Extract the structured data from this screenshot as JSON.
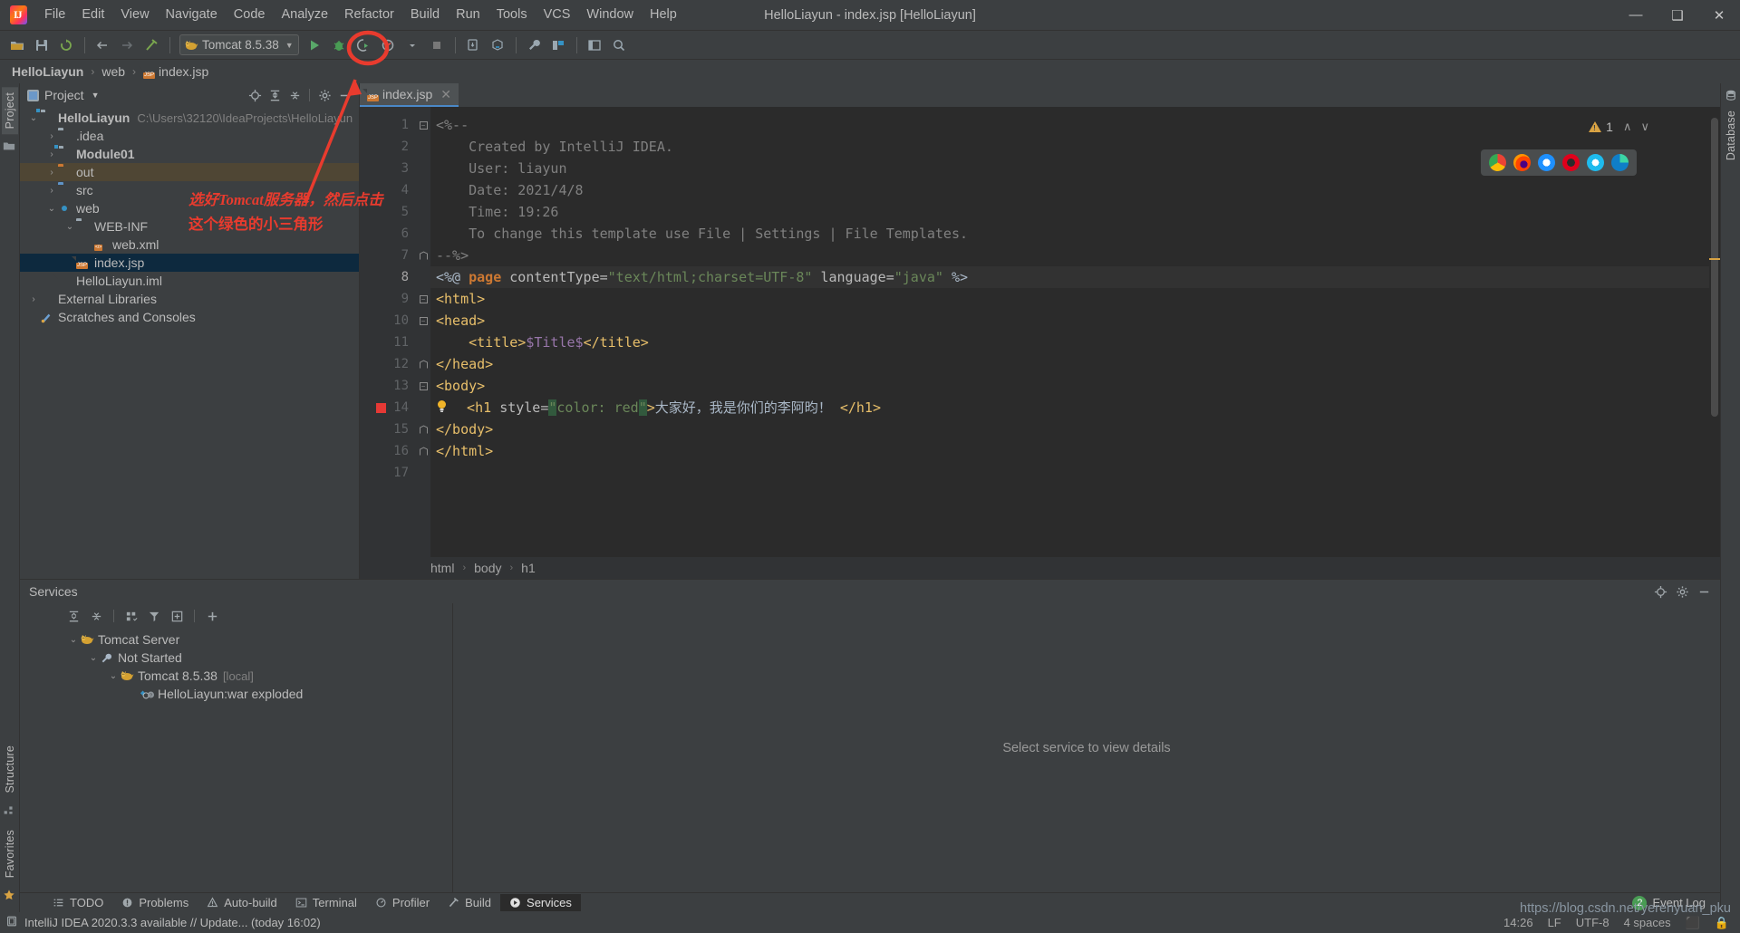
{
  "window": {
    "title": "HelloLiayun - index.jsp [HelloLiayun]",
    "minimize": "—",
    "maximize": "❑",
    "close": "✕"
  },
  "menubar": [
    {
      "label": "File"
    },
    {
      "label": "Edit"
    },
    {
      "label": "View"
    },
    {
      "label": "Navigate"
    },
    {
      "label": "Code"
    },
    {
      "label": "Analyze"
    },
    {
      "label": "Refactor"
    },
    {
      "label": "Build"
    },
    {
      "label": "Run"
    },
    {
      "label": "Tools"
    },
    {
      "label": "VCS"
    },
    {
      "label": "Window"
    },
    {
      "label": "Help"
    }
  ],
  "toolbar": {
    "run_config": "Tomcat 8.5.38",
    "caret": "▼",
    "icons": [
      "open-folder-icon",
      "save-all-icon",
      "sync-icon",
      "back-icon",
      "forward-icon",
      "build-hammer-icon",
      "run-icon",
      "debug-icon",
      "run-coverage-icon",
      "profiler-icon",
      "stop-icon",
      "update-app-icon",
      "deploy-icon",
      "settings-wrench-icon",
      "project-structure-icon",
      "layout-icon",
      "search-icon"
    ]
  },
  "navbar": {
    "crumbs": [
      {
        "label": "HelloLiayun",
        "bold": true
      },
      {
        "label": "web",
        "bold": false
      },
      {
        "label": "index.jsp",
        "bold": false
      }
    ],
    "separator": "›"
  },
  "left_strip": {
    "tabs": [
      {
        "label": "Project",
        "active": true
      }
    ],
    "extra_icon": "structure-folder-icon"
  },
  "left_strip_bottom": {
    "tabs": [
      {
        "label": "Structure"
      },
      {
        "label": "Favorites"
      }
    ]
  },
  "right_strip": {
    "tabs": [
      {
        "label": "Database"
      }
    ]
  },
  "project_panel": {
    "title": "Project",
    "caret": "▼",
    "actions": [
      "locate-target-icon",
      "expand-all-icon",
      "collapse-all-icon",
      "gear-icon",
      "hide-icon"
    ],
    "tree": [
      {
        "indent": 0,
        "arrow": "⌄",
        "icon": "folder-module-icon",
        "label": "HelloLiayun",
        "bold": true,
        "path": "C:\\Users\\32120\\IdeaProjects\\HelloLiayun",
        "state": "normal"
      },
      {
        "indent": 1,
        "arrow": "›",
        "icon": "folder-icon",
        "label": ".idea",
        "bold": false,
        "path": "",
        "state": "normal"
      },
      {
        "indent": 1,
        "arrow": "›",
        "icon": "folder-module-icon",
        "label": "Module01",
        "bold": true,
        "path": "",
        "state": "normal"
      },
      {
        "indent": 1,
        "arrow": "›",
        "icon": "folder-out-icon",
        "label": "out",
        "bold": false,
        "path": "",
        "state": "highlight"
      },
      {
        "indent": 1,
        "arrow": "›",
        "icon": "folder-source-icon",
        "label": "src",
        "bold": false,
        "path": "",
        "state": "normal"
      },
      {
        "indent": 1,
        "arrow": "⌄",
        "icon": "folder-web-icon",
        "label": "web",
        "bold": false,
        "path": "",
        "state": "normal"
      },
      {
        "indent": 2,
        "arrow": "⌄",
        "icon": "folder-icon",
        "label": "WEB-INF",
        "bold": false,
        "path": "",
        "state": "normal"
      },
      {
        "indent": 3,
        "arrow": "",
        "icon": "xml-file-icon",
        "label": "web.xml",
        "bold": false,
        "path": "",
        "state": "normal"
      },
      {
        "indent": 2,
        "arrow": "",
        "icon": "jsp-file-icon",
        "label": "index.jsp",
        "bold": false,
        "path": "",
        "state": "selected"
      },
      {
        "indent": 1,
        "arrow": "",
        "icon": "iml-file-icon",
        "label": "HelloLiayun.iml",
        "bold": false,
        "path": "",
        "state": "normal"
      },
      {
        "indent": 0,
        "arrow": "›",
        "icon": "library-icon",
        "label": "External Libraries",
        "bold": false,
        "path": "",
        "state": "normal"
      },
      {
        "indent": 0,
        "arrow": "",
        "icon": "scratches-icon",
        "label": "Scratches and Consoles",
        "bold": false,
        "path": "",
        "state": "normal"
      }
    ]
  },
  "editor": {
    "tab": {
      "label": "index.jsp",
      "icon": "jsp-file-icon",
      "close": "✕"
    },
    "warning": {
      "count": "1",
      "icon": "warning-triangle-icon",
      "up": "∧",
      "down": "∨"
    },
    "browsers": [
      "chrome-icon",
      "firefox-icon",
      "safari-icon",
      "opera-icon",
      "internet-explorer-icon",
      "edge-icon"
    ],
    "lines": [
      {
        "n": "1",
        "fold": "minus",
        "segs": [
          {
            "t": "<%--",
            "c": "c-comment"
          }
        ]
      },
      {
        "n": "2",
        "fold": "",
        "segs": [
          {
            "t": "    Created by IntelliJ IDEA.",
            "c": "c-comment"
          }
        ]
      },
      {
        "n": "3",
        "fold": "",
        "segs": [
          {
            "t": "    User: liayun",
            "c": "c-comment"
          }
        ]
      },
      {
        "n": "4",
        "fold": "",
        "segs": [
          {
            "t": "    Date: 2021/4/8",
            "c": "c-comment"
          }
        ]
      },
      {
        "n": "5",
        "fold": "",
        "segs": [
          {
            "t": "    Time: 19:26",
            "c": "c-comment"
          }
        ]
      },
      {
        "n": "6",
        "fold": "",
        "segs": [
          {
            "t": "    To change this template use File | Settings | File Templates.",
            "c": "c-comment"
          }
        ]
      },
      {
        "n": "7",
        "fold": "end",
        "segs": [
          {
            "t": "--%>",
            "c": "c-comment"
          }
        ]
      },
      {
        "n": "8",
        "fold": "",
        "highlight": true,
        "segs": [
          {
            "t": "<%@ ",
            "c": "c-jsp"
          },
          {
            "t": "page",
            "c": "c-kw"
          },
          {
            "t": " contentType=",
            "c": "c-attr"
          },
          {
            "t": "\"text/html;charset=UTF-8\"",
            "c": "c-str"
          },
          {
            "t": " language=",
            "c": "c-attr"
          },
          {
            "t": "\"java\"",
            "c": "c-str"
          },
          {
            "t": " %>",
            "c": "c-jsp"
          }
        ]
      },
      {
        "n": "9",
        "fold": "minus",
        "segs": [
          {
            "t": "<html>",
            "c": "c-tag"
          }
        ]
      },
      {
        "n": "10",
        "fold": "minus",
        "segs": [
          {
            "t": "<head>",
            "c": "c-tag"
          }
        ]
      },
      {
        "n": "11",
        "fold": "",
        "segs": [
          {
            "t": "    <title>",
            "c": "c-tag"
          },
          {
            "t": "$Title$",
            "c": "c-el"
          },
          {
            "t": "</title>",
            "c": "c-tag"
          }
        ]
      },
      {
        "n": "12",
        "fold": "end",
        "segs": [
          {
            "t": "</head>",
            "c": "c-tag"
          }
        ]
      },
      {
        "n": "13",
        "fold": "minus",
        "segs": [
          {
            "t": "<body>",
            "c": "c-tag"
          }
        ]
      },
      {
        "n": "14",
        "fold": "",
        "breakpoint": true,
        "bulb": true,
        "segs": [
          {
            "t": "  <h1 ",
            "c": "c-tag"
          },
          {
            "t": "style=",
            "c": "c-attr"
          },
          {
            "t": "\"",
            "c": "c-str c-strbg"
          },
          {
            "t": "color: red",
            "c": "c-str"
          },
          {
            "t": "\"",
            "c": "c-str c-strbg"
          },
          {
            "t": ">",
            "c": "c-tag"
          },
          {
            "t": "大家好，我是你们的李阿昀！",
            "c": "c-txt"
          },
          {
            "t": " </h1>",
            "c": "c-tag"
          }
        ]
      },
      {
        "n": "15",
        "fold": "end",
        "segs": [
          {
            "t": "</body>",
            "c": "c-tag"
          }
        ]
      },
      {
        "n": "16",
        "fold": "end",
        "segs": [
          {
            "t": "</html>",
            "c": "c-tag"
          }
        ]
      },
      {
        "n": "17",
        "fold": "",
        "segs": [
          {
            "t": "",
            "c": "c-txt"
          }
        ]
      }
    ],
    "breadcrumbs": [
      "html",
      "body",
      "h1"
    ],
    "breadcrumb_sep": "›"
  },
  "services": {
    "title": "Services",
    "actions": [
      "locate-target-icon",
      "gear-icon",
      "hide-icon"
    ],
    "toolbar_icons": [
      "expand-all-icon",
      "collapse-all-icon",
      "group-by-icon",
      "filter-icon",
      "add-tab-icon",
      "add-icon"
    ],
    "tree": [
      {
        "indent": 0,
        "arrow": "⌄",
        "icon": "tomcat-icon",
        "label": "Tomcat Server",
        "suffix": ""
      },
      {
        "indent": 1,
        "arrow": "⌄",
        "icon": "wrench-icon",
        "label": "Not Started",
        "suffix": ""
      },
      {
        "indent": 2,
        "arrow": "⌄",
        "icon": "tomcat-icon",
        "label": "Tomcat 8.5.38",
        "suffix": "[local]"
      },
      {
        "indent": 3,
        "arrow": "",
        "icon": "artifact-icon",
        "label": "HelloLiayun:war exploded",
        "suffix": ""
      }
    ],
    "detail_placeholder": "Select service to view details"
  },
  "bottom_bar": {
    "items": [
      {
        "label": "TODO",
        "icon": "todo-list-icon",
        "active": false
      },
      {
        "label": "Problems",
        "icon": "problems-icon",
        "active": false
      },
      {
        "label": "Auto-build",
        "icon": "warning-triangle-icon",
        "active": false
      },
      {
        "label": "Terminal",
        "icon": "terminal-icon",
        "active": false
      },
      {
        "label": "Profiler",
        "icon": "profiler-icon",
        "active": false
      },
      {
        "label": "Build",
        "icon": "build-hammer-icon",
        "active": false
      },
      {
        "label": "Services",
        "icon": "services-play-icon",
        "active": true
      }
    ],
    "event_log": {
      "label": "Event Log",
      "count": "2"
    }
  },
  "statusbar": {
    "icon": "status-memory-icon",
    "message": "IntelliJ IDEA 2020.3.3 available // Update... (today 16:02)",
    "right": [
      "14:26",
      "LF",
      "UTF-8",
      "4 spaces",
      "⬛",
      "🔒"
    ],
    "watermark": "https://blog.csdn.net/yerenyuan_pku"
  },
  "annotation": {
    "line1": "选好Tomcat服务器，然后点击",
    "line2": "这个绿色的小三角形",
    "color": "#e83b2e"
  },
  "colors": {
    "accent_blue": "#4a88c7",
    "selection": "#0d293e",
    "highlight_row": "#4f4634",
    "annotation_red": "#e83b2e",
    "editor_bg": "#2b2b2b",
    "panel_bg": "#3c3f41"
  }
}
